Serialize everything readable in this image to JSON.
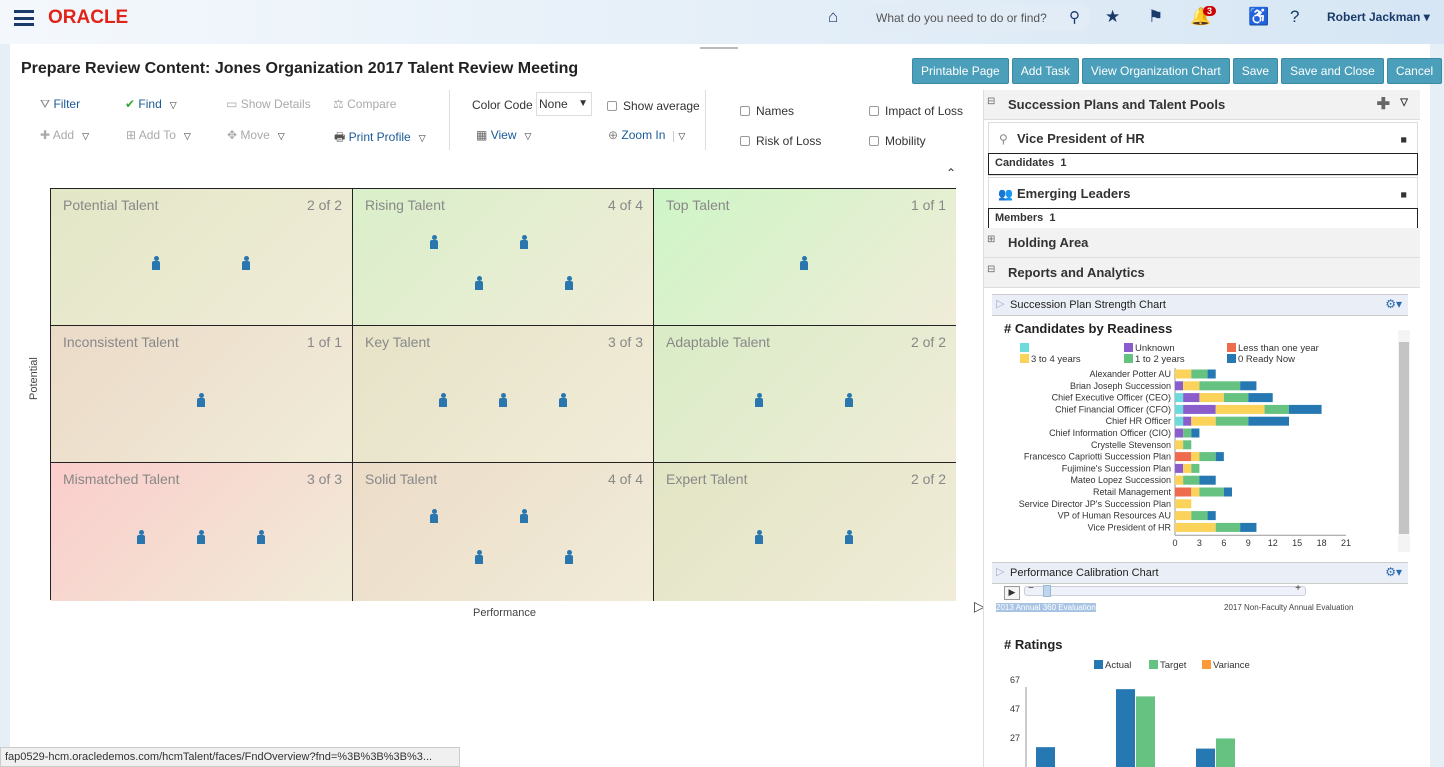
{
  "header": {
    "logo": "ORACLE",
    "search_placeholder": "What do you need to do or find?",
    "notifications_count": "3",
    "user": "Robert Jackman"
  },
  "page": {
    "title": "Prepare Review Content: Jones Organization 2017 Talent Review Meeting",
    "buttons": [
      "Printable Page",
      "Add Task",
      "View Organization Chart",
      "Save",
      "Save and Close",
      "Cancel"
    ]
  },
  "toolbar": {
    "filter": "Filter",
    "find": "Find",
    "show_details": "Show Details",
    "compare": "Compare",
    "add": "Add",
    "add_to": "Add To",
    "move": "Move",
    "print_profile": "Print Profile",
    "color_code_label": "Color Code",
    "color_code_value": "None",
    "show_average": "Show average",
    "view": "View",
    "zoom_in": "Zoom In",
    "names": "Names",
    "impact_of_loss": "Impact of Loss",
    "risk_of_loss": "Risk of Loss",
    "mobility": "Mobility"
  },
  "grid": {
    "y_label": "Potential",
    "x_label": "Performance",
    "cells": [
      {
        "name": "Potential Talent",
        "count": "2 of 2",
        "people": 2,
        "color": "#e3e7c6"
      },
      {
        "name": "Rising Talent",
        "count": "4 of 4",
        "people": 4,
        "color": "#d9efc9"
      },
      {
        "name": "Top Talent",
        "count": "1 of 1",
        "people": 1,
        "color": "#cef5c6"
      },
      {
        "name": "Inconsistent Talent",
        "count": "1 of 1",
        "people": 1,
        "color": "#ecdac8"
      },
      {
        "name": "Key Talent",
        "count": "3 of 3",
        "people": 3,
        "color": "#e7e3c8"
      },
      {
        "name": "Adaptable Talent",
        "count": "2 of 2",
        "people": 2,
        "color": "#d9ecc6"
      },
      {
        "name": "Mismatched Talent",
        "count": "3 of 3",
        "people": 3,
        "color": "#fbcdcb"
      },
      {
        "name": "Solid Talent",
        "count": "4 of 4",
        "people": 4,
        "color": "#ecdcc8"
      },
      {
        "name": "Expert Talent",
        "count": "2 of 2",
        "people": 2,
        "color": "#e2e5c4"
      }
    ]
  },
  "status_url": "fap0529-hcm.oracledemos.com/hcmTalent/faces/FndOverview?fnd=%3B%3B%3B%3...",
  "right": {
    "succession_header": "Succession Plans and Talent Pools",
    "card1": {
      "title": "Vice President of HR",
      "label": "Candidates",
      "value": "1"
    },
    "card2": {
      "title": "Emerging Leaders",
      "label": "Members",
      "value": "1"
    },
    "holding": "Holding Area",
    "reports": "Reports and Analytics",
    "chart1_header": "Succession Plan Strength Chart",
    "chart2_header": "Performance Calibration Chart",
    "slider_start": "2013 Annual 360 Evaluation",
    "slider_end": "2017 Non-Faculty Annual Evaluation"
  },
  "chart_data": [
    {
      "type": "bar",
      "orientation": "horizontal",
      "stacked": true,
      "title": "# Candidates by Readiness",
      "xlim": [
        0,
        21
      ],
      "xticks": [
        0,
        3,
        6,
        9,
        12,
        15,
        18,
        21
      ],
      "legend": "top",
      "categories": [
        "Alexander Potter AU",
        "Brian Joseph Succession",
        "Chief Executive Officer (CEO)",
        "Chief Financial Officer (CFO)",
        "Chief HR Officer",
        "Chief Information Officer (CIO)",
        "Crystelle Stevenson",
        "Francesco Capriotti Succession Plan",
        "Fujimine's Succession Plan",
        "Mateo Lopez Succession",
        "Retail Management",
        "Service Director JP's Succession Plan",
        "VP of Human Resources AU",
        "Vice President of HR"
      ],
      "series": [
        {
          "name": "",
          "color": "#6ddbdb",
          "values": [
            0,
            0,
            1,
            1,
            1,
            0,
            0,
            0,
            0,
            0,
            0,
            0,
            0,
            0
          ]
        },
        {
          "name": "Unknown",
          "color": "#8a5ccc",
          "values": [
            0,
            1,
            2,
            4,
            1,
            1,
            0,
            0,
            1,
            0,
            0,
            0,
            0,
            0
          ]
        },
        {
          "name": "Less than one year",
          "color": "#ef6b4e",
          "values": [
            0,
            0,
            0,
            0,
            0,
            0,
            0,
            2,
            0,
            0,
            2,
            0,
            0,
            0
          ]
        },
        {
          "name": "3 to 4 years",
          "color": "#fbd35a",
          "values": [
            2,
            2,
            3,
            6,
            3,
            0,
            1,
            1,
            1,
            1,
            1,
            2,
            2,
            5
          ]
        },
        {
          "name": "1 to 2 years",
          "color": "#66c281",
          "values": [
            2,
            5,
            3,
            3,
            4,
            1,
            1,
            2,
            1,
            2,
            3,
            0,
            2,
            3
          ]
        },
        {
          "name": "0 Ready Now",
          "color": "#2678b2",
          "values": [
            1,
            2,
            3,
            4,
            5,
            1,
            0,
            1,
            0,
            2,
            1,
            0,
            1,
            2
          ]
        }
      ]
    },
    {
      "type": "bar",
      "title": "# Ratings",
      "yticks": [
        27,
        47,
        67
      ],
      "legend": "top",
      "series": [
        {
          "name": "Actual",
          "color": "#2678b2",
          "values": [
            20,
            60,
            19
          ]
        },
        {
          "name": "Target",
          "color": "#66c281",
          "values": [
            null,
            55,
            26
          ]
        },
        {
          "name": "Variance",
          "color": "#fb9a3a",
          "values": [
            null,
            null,
            null
          ]
        }
      ]
    }
  ]
}
